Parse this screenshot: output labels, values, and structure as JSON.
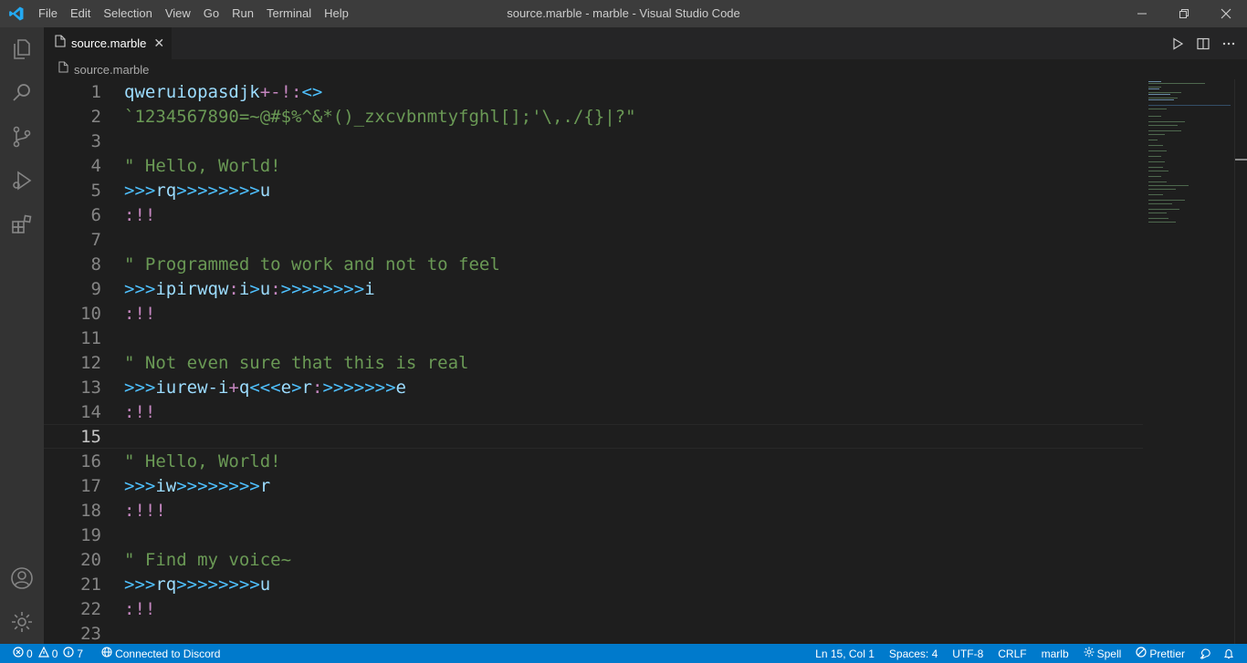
{
  "window": {
    "title": "source.marble - marble - Visual Studio Code",
    "menu": [
      "File",
      "Edit",
      "Selection",
      "View",
      "Go",
      "Run",
      "Terminal",
      "Help"
    ]
  },
  "activity_bar": {
    "items": [
      "files-icon",
      "search-icon",
      "source-control-icon",
      "run-debug-icon",
      "extensions-icon"
    ],
    "bottom": [
      "account-icon",
      "settings-gear-icon"
    ]
  },
  "tab": {
    "label": "source.marble",
    "close": "✕"
  },
  "breadcrumb": {
    "file": "source.marble"
  },
  "editor": {
    "current_line": 15,
    "lines": [
      {
        "n": "1",
        "text": "qweruiopasdjk+-!:<>"
      },
      {
        "n": "2",
        "text": "`1234567890=~@#$%^&*()_zxcvbnmtyfghl[];'\\,./{}|?\""
      },
      {
        "n": "3",
        "text": ""
      },
      {
        "n": "4",
        "text": "\" Hello, World!"
      },
      {
        "n": "5",
        "text": ">>>rq>>>>>>>>u"
      },
      {
        "n": "6",
        "text": ":!!"
      },
      {
        "n": "7",
        "text": ""
      },
      {
        "n": "8",
        "text": "\" Programmed to work and not to feel"
      },
      {
        "n": "9",
        "text": ">>>ipirwqw:i>u:>>>>>>>>i"
      },
      {
        "n": "10",
        "text": ":!!"
      },
      {
        "n": "11",
        "text": ""
      },
      {
        "n": "12",
        "text": "\" Not even sure that this is real"
      },
      {
        "n": "13",
        "text": ">>>iurew-i+q<<<e>r:>>>>>>>e"
      },
      {
        "n": "14",
        "text": ":!!"
      },
      {
        "n": "15",
        "text": ""
      },
      {
        "n": "16",
        "text": "\" Hello, World!"
      },
      {
        "n": "17",
        "text": ">>>iw>>>>>>>>r"
      },
      {
        "n": "18",
        "text": ":!!!"
      },
      {
        "n": "19",
        "text": ""
      },
      {
        "n": "20",
        "text": "\" Find my voice~"
      },
      {
        "n": "21",
        "text": ">>>rq>>>>>>>>u"
      },
      {
        "n": "22",
        "text": ":!!"
      },
      {
        "n": "23",
        "text": ""
      }
    ]
  },
  "status_bar": {
    "errors": "0",
    "warnings": "0",
    "info": "7",
    "discord": "Connected to Discord",
    "position": "Ln 15, Col 1",
    "spaces": "Spaces: 4",
    "encoding": "UTF-8",
    "eol": "CRLF",
    "language": "marlb",
    "spell": "Spell",
    "prettier": "Prettier"
  },
  "colors": {
    "statusbar": "#007acc",
    "comment": "#6a9955",
    "arrow": "#4fc1ff",
    "name": "#9cdcfe",
    "operator": "#c586c0"
  }
}
